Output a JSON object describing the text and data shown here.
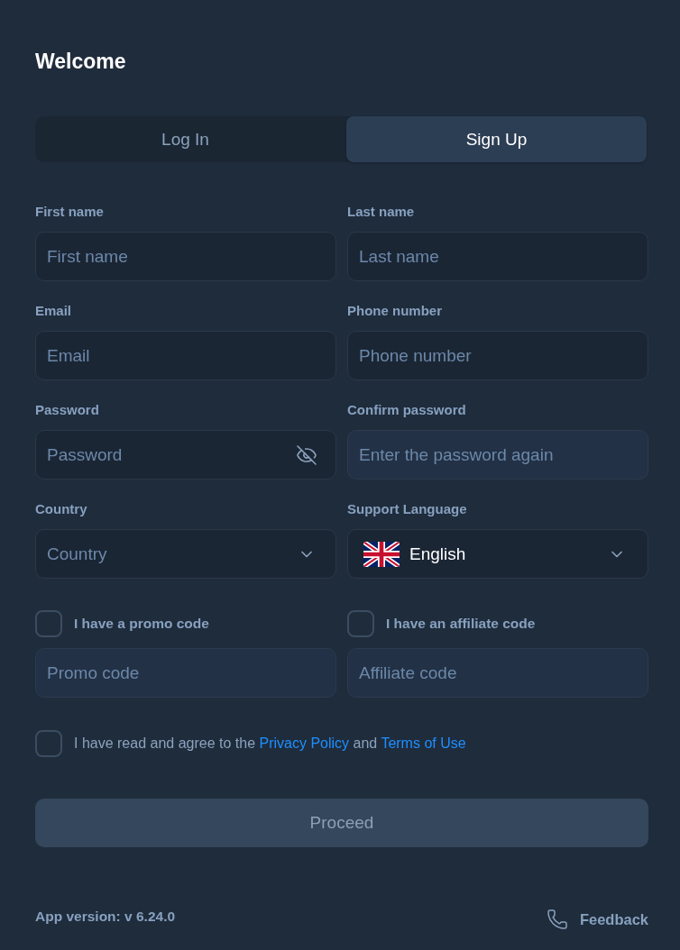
{
  "title": "Welcome",
  "tabs": [
    {
      "label": "Log In",
      "selected": false
    },
    {
      "label": "Sign Up",
      "selected": true
    }
  ],
  "fields": [
    {
      "kind": "text",
      "label": "First name",
      "placeholder": "First name",
      "disabled": false
    },
    {
      "kind": "text",
      "label": "Last name",
      "placeholder": "Last name",
      "disabled": false
    },
    {
      "kind": "text",
      "label": "Email",
      "placeholder": "Email",
      "disabled": false
    },
    {
      "kind": "text",
      "label": "Phone number",
      "placeholder": "Phone number",
      "disabled": false
    },
    {
      "kind": "password",
      "label": "Password",
      "placeholder": "Password",
      "disabled": false
    },
    {
      "kind": "text",
      "label": "Confirm password",
      "placeholder": "Enter the password again",
      "disabled": true
    },
    {
      "kind": "select",
      "label": "Country",
      "placeholder": "Country",
      "disabled": false
    },
    {
      "kind": "language",
      "label": "Support Language",
      "value": "English",
      "disabled": false
    }
  ],
  "code_options": [
    {
      "label": "I have a promo code",
      "checked": false,
      "placeholder": "Promo code",
      "disabled": true
    },
    {
      "label": "I have an affiliate code",
      "checked": false,
      "placeholder": "Affiliate code",
      "disabled": true
    }
  ],
  "agreement": {
    "checked": false,
    "parts": [
      {
        "kind": "text",
        "text": "I have read and agree to the"
      },
      {
        "kind": "link",
        "text": "Privacy Policy"
      },
      {
        "kind": "text",
        "text": "and"
      },
      {
        "kind": "link",
        "text": "Terms of Use"
      }
    ]
  },
  "proceed": {
    "label": "Proceed",
    "disabled": true
  },
  "footer": {
    "version": "App version: v 6.24.0",
    "feedback": "Feedback"
  }
}
